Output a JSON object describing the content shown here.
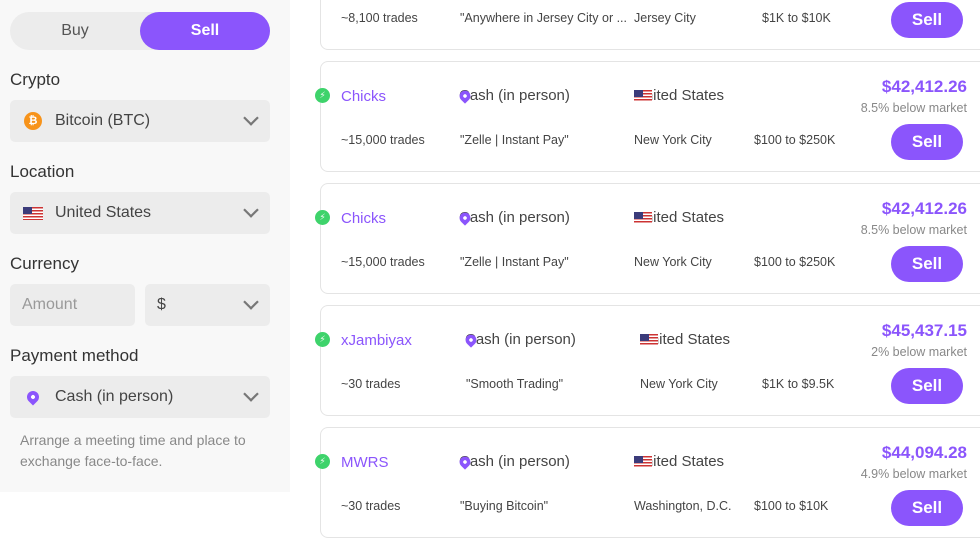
{
  "sidebar": {
    "buy": "Buy",
    "sell": "Sell",
    "crypto_label": "Crypto",
    "crypto_value": "Bitcoin (BTC)",
    "location_label": "Location",
    "location_value": "United States",
    "currency_label": "Currency",
    "amount_placeholder": "Amount",
    "currency_value": "$",
    "payment_label": "Payment method",
    "payment_value": "Cash (in person)",
    "note": "Arrange a meeting time and place to exchange face-to-face."
  },
  "accent": "#8b55fc",
  "offers": [
    {
      "trades": "~8,100 trades",
      "terms": "\"Anywhere in Jersey City or ...",
      "city": "Jersey City",
      "limits": "$1K to $10K",
      "button": "Sell"
    },
    {
      "name": "Chicks",
      "method": "Cash (in person)",
      "country": "United States",
      "trades": "~15,000 trades",
      "terms": "\"Zelle | Instant Pay\"",
      "city": "New York City",
      "limits": "$100 to $250K",
      "price": "$42,412.26",
      "below": "8.5% below market",
      "button": "Sell"
    },
    {
      "name": "Chicks",
      "method": "Cash (in person)",
      "country": "United States",
      "trades": "~15,000 trades",
      "terms": "\"Zelle | Instant Pay\"",
      "city": "New York City",
      "limits": "$100 to $250K",
      "price": "$42,412.26",
      "below": "8.5% below market",
      "button": "Sell"
    },
    {
      "name": "xJambiyax",
      "method": "Cash (in person)",
      "country": "United States",
      "trades": "~30 trades",
      "terms": "\"Smooth Trading\"",
      "city": "New York City",
      "limits": "$1K to $9.5K",
      "price": "$45,437.15",
      "below": "2% below market",
      "button": "Sell"
    },
    {
      "name": "MWRS",
      "method": "Cash (in person)",
      "country": "United States",
      "trades": "~30 trades",
      "terms": "\"Buying Bitcoin\"",
      "city": "Washington, D.C.",
      "limits": "$100 to $10K",
      "price": "$44,094.28",
      "below": "4.9% below market",
      "button": "Sell"
    }
  ]
}
